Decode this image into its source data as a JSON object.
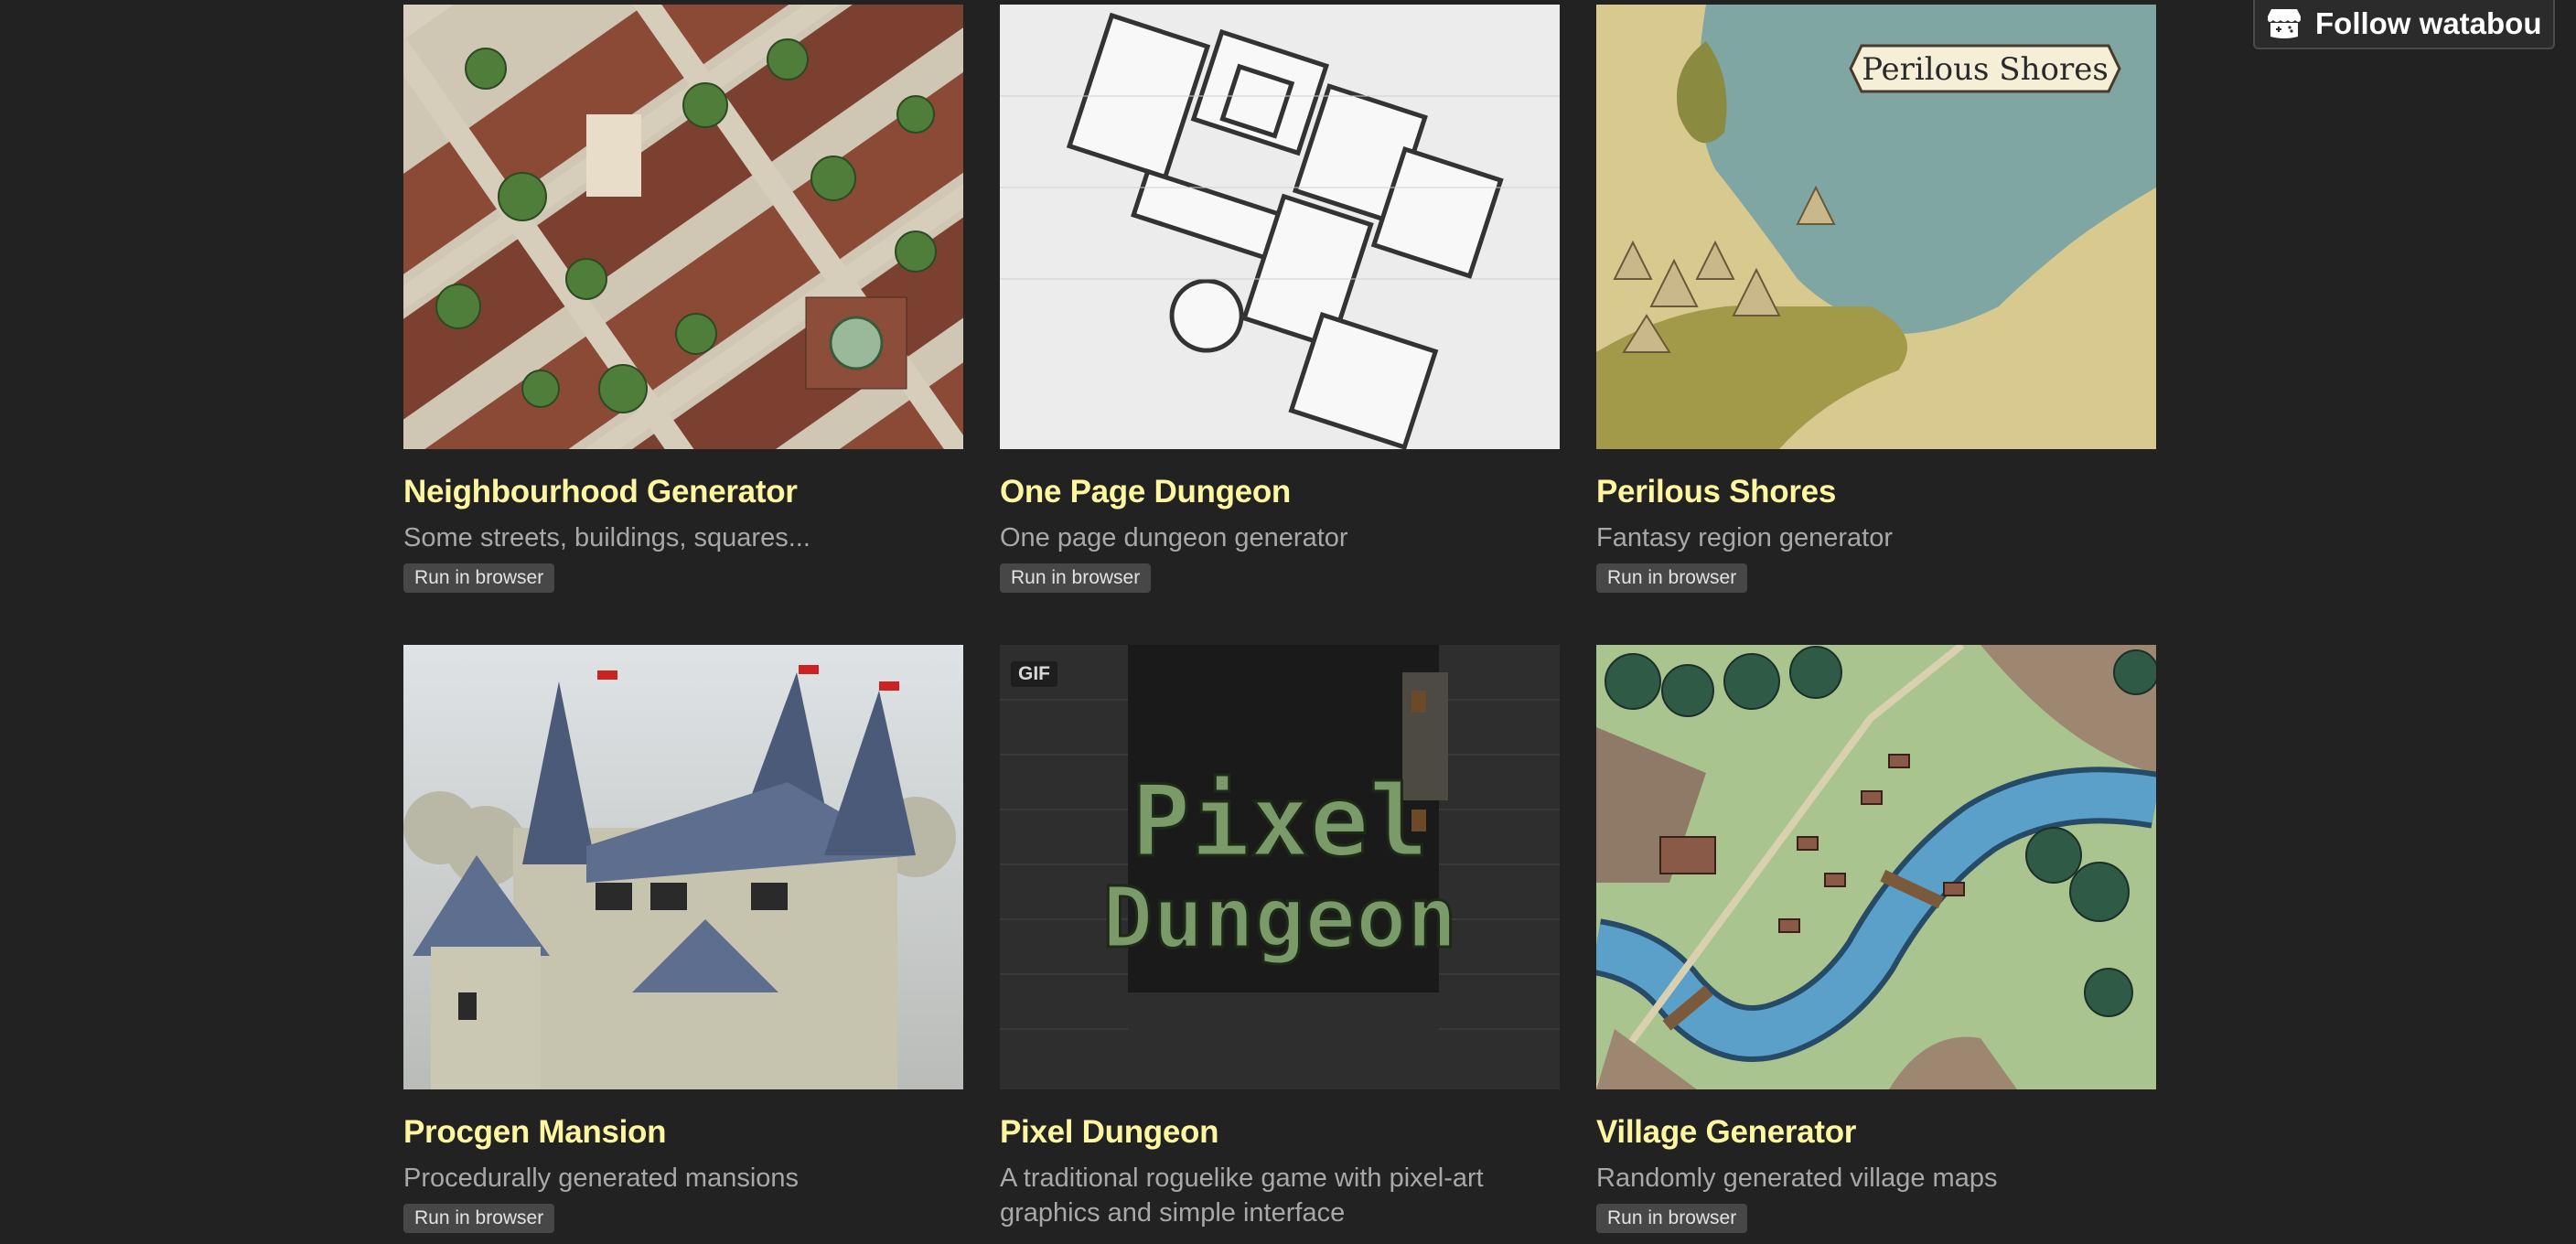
{
  "follow": {
    "label": "Follow watabou",
    "icon": "itchio-controller-icon"
  },
  "cards": [
    {
      "title": "Neighbourhood Generator",
      "description": "Some streets, buildings, squares...",
      "tag": "Run in browser"
    },
    {
      "title": "One Page Dungeon",
      "description": "One page dungeon generator",
      "tag": "Run in browser"
    },
    {
      "title": "Perilous Shores",
      "description": "Fantasy region generator",
      "tag": "Run in browser",
      "thumb_text": "Perilous Shores"
    },
    {
      "title": "Procgen Mansion",
      "description": "Procedurally generated mansions",
      "tag": "Run in browser"
    },
    {
      "title": "Pixel Dungeon",
      "description": "A traditional roguelike game with pixel-art graphics and simple interface",
      "badge": "GIF",
      "thumb_text_1": "Pixel",
      "thumb_text_2": "Dungeon"
    },
    {
      "title": "Village Generator",
      "description": "Randomly generated village maps",
      "tag": "Run in browser"
    }
  ],
  "colors": {
    "background": "#222222",
    "title": "#fff7a0",
    "description": "#a8a8a8",
    "tag_bg": "#474747"
  }
}
